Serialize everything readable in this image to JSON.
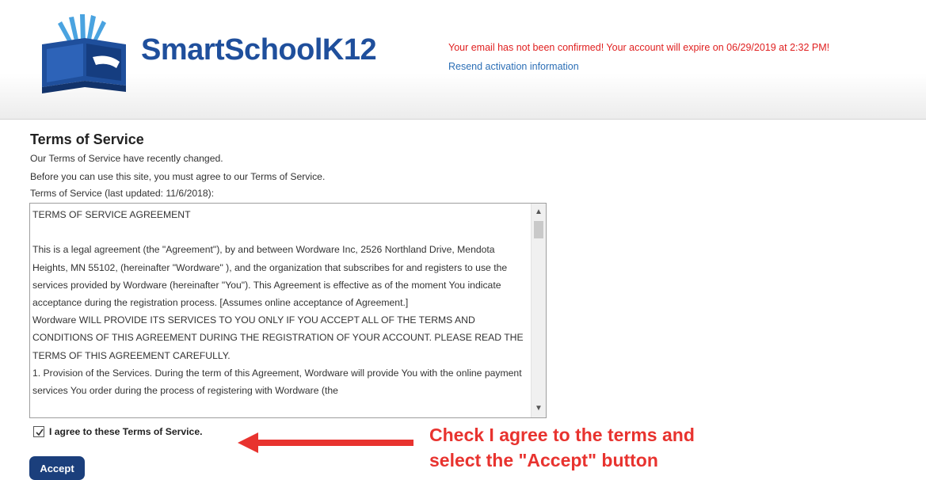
{
  "header": {
    "logo_text": "SmartSchoolK12",
    "notice": "Your email has not been confirmed! Your account will expire on 06/29/2019 at 2:32 PM!",
    "resend_link": "Resend activation information"
  },
  "main": {
    "title": "Terms of Service",
    "changed_notice": "Our Terms of Service have recently changed.",
    "must_agree": "Before you can use this site, you must agree to our Terms of Service.",
    "last_updated": "Terms of Service (last updated: 11/6/2018):",
    "tos_text": {
      "heading": "TERMS OF SERVICE AGREEMENT",
      "para1": "This is a legal agreement (the \"Agreement\"), by and between Wordware Inc, 2526 Northland Drive, Mendota Heights, MN 55102, (hereinafter \"Wordware\" ), and the organization that subscribes for and registers to use the services provided by Wordware (hereinafter \"You\"). This Agreement is effective as of the moment You indicate acceptance during the registration process. [Assumes online acceptance of Agreement.]",
      "para2": "Wordware WILL PROVIDE ITS SERVICES TO YOU ONLY IF YOU ACCEPT ALL OF THE TERMS AND CONDITIONS OF THIS AGREEMENT DURING THE REGISTRATION OF YOUR ACCOUNT. PLEASE READ THE TERMS OF THIS AGREEMENT CAREFULLY.",
      "para3": "1. Provision of the Services. During the term of this Agreement, Wordware will provide You with the online payment services You order during the process of registering with Wordware (the"
    },
    "agree_label": "I agree to these Terms of Service.",
    "agree_checked": true,
    "accept_label": "Accept"
  },
  "annotation": {
    "line1": "Check I agree to the terms and",
    "line2": "select the \"Accept\" button",
    "color": "#e8332f"
  },
  "colors": {
    "brand": "#1f4f9c",
    "notice": "#e02020",
    "link": "#2c6fb6",
    "button": "#1b3f7c"
  }
}
